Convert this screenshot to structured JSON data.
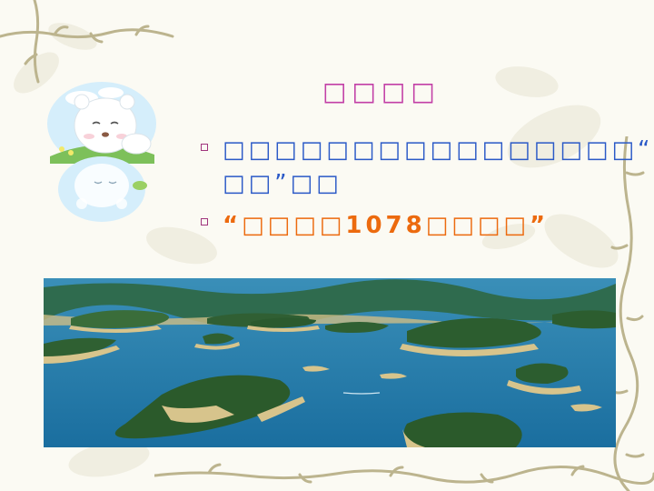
{
  "slide": {
    "title": "□□□□",
    "bullet1_line1": "□□□□□□□□□□□□□□□□“□",
    "bullet1_line2": "□□”□□",
    "bullet2_text": "“□□□□1078□□□□”"
  },
  "colors": {
    "title": "#c23fa6",
    "text_blue": "#2a59c7",
    "text_orange": "#ec6a0e",
    "bullet": "#a0357d",
    "lake_water": "#1f7fb0",
    "island_green": "#2e6a2c",
    "shore_sand": "#d8c790"
  },
  "icons": {
    "mascot": "polar-bear-cub-icon",
    "photo": "lake-with-islands-image",
    "decoration": "vine-border"
  }
}
